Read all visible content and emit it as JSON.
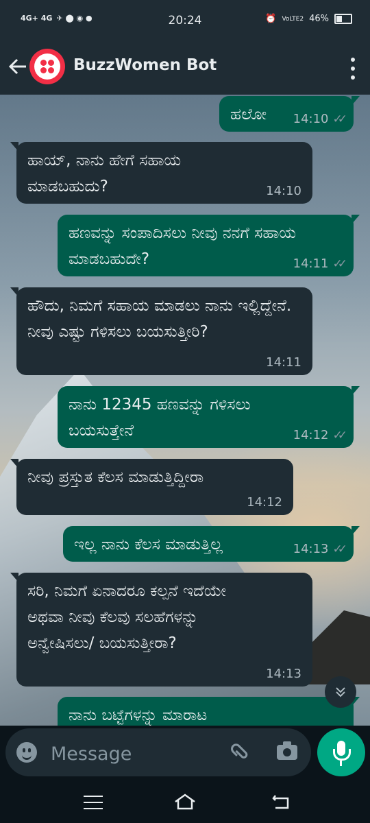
{
  "status_bar": {
    "left_indicators": "4G+ 4G",
    "time": "20:24",
    "network": "VoLTE2",
    "battery": "46%"
  },
  "header": {
    "title": "BuzzWomen Bot"
  },
  "messages": [
    {
      "direction": "out",
      "text": "ಹಲೋ",
      "time": "14:10"
    },
    {
      "direction": "in",
      "text": "ಹಾಯ್, ನಾನು ಹೇಗೆ ಸಹಾಯ ಮಾಡಬಹುದು?",
      "time": "14:10"
    },
    {
      "direction": "out",
      "text": "ಹಣವನ್ನು ಸಂಪಾದಿಸಲು ನೀವು ನನಗೆ ಸಹಾಯ ಮಾಡಬಹುದೇ?",
      "time": "14:11"
    },
    {
      "direction": "in",
      "text": "ಹೌದು, ನಿಮಗೆ ಸಹಾಯ ಮಾಡಲು ನಾನು ಇಲ್ಲಿದ್ದೇನೆ. ನೀವು ಎಷ್ಟು ಗಳಿಸಲು ಬಯಸುತ್ತೀರಿ?",
      "time": "14:11"
    },
    {
      "direction": "out",
      "text": "ನಾನು 12345 ಹಣವನ್ನು ಗಳಿಸಲು ಬಯಸುತ್ತೇನೆ",
      "time": "14:12"
    },
    {
      "direction": "in",
      "text": "ನೀವು ಪ್ರಸ್ತುತ ಕೆಲಸ ಮಾಡುತ್ತಿದ್ದೀರಾ",
      "time": "14:12"
    },
    {
      "direction": "out",
      "text": "ಇಲ್ಲ ನಾನು ಕೆಲಸ ಮಾಡುತ್ತಿಲ್ಲ",
      "time": "14:13"
    },
    {
      "direction": "in",
      "text": "ಸರಿ, ನಿಮಗೆ ಏನಾದರೂ ಕಲ್ಪನೆ ಇದೆಯೇ ಅಥವಾ ನೀವು ಕೆಲವು ಸಲಹೆಗಳನ್ನು ಅನ್ವೇಷಿಸಲು/ ಬಯಸುತ್ತೀರಾ?",
      "time": "14:13"
    },
    {
      "direction": "out",
      "text": "ನಾನು ಬಟ್ಟೆಗಳನ್ನು ಮಾರಾಟ",
      "time": ""
    }
  ],
  "composer": {
    "placeholder": "Message"
  },
  "icons": [
    "back-arrow-icon",
    "menu-dots-icon",
    "double-check-icon",
    "chevron-double-down-icon",
    "emoji-icon",
    "attach-icon",
    "camera-icon",
    "mic-icon",
    "nav-menu-icon",
    "nav-home-icon",
    "nav-back-icon"
  ],
  "colors": {
    "header": "#1f2c34",
    "outgoing_bubble": "#005c4b",
    "incoming_bubble": "#1f2c34",
    "accent": "#00a884",
    "avatar": "#f22f46"
  }
}
